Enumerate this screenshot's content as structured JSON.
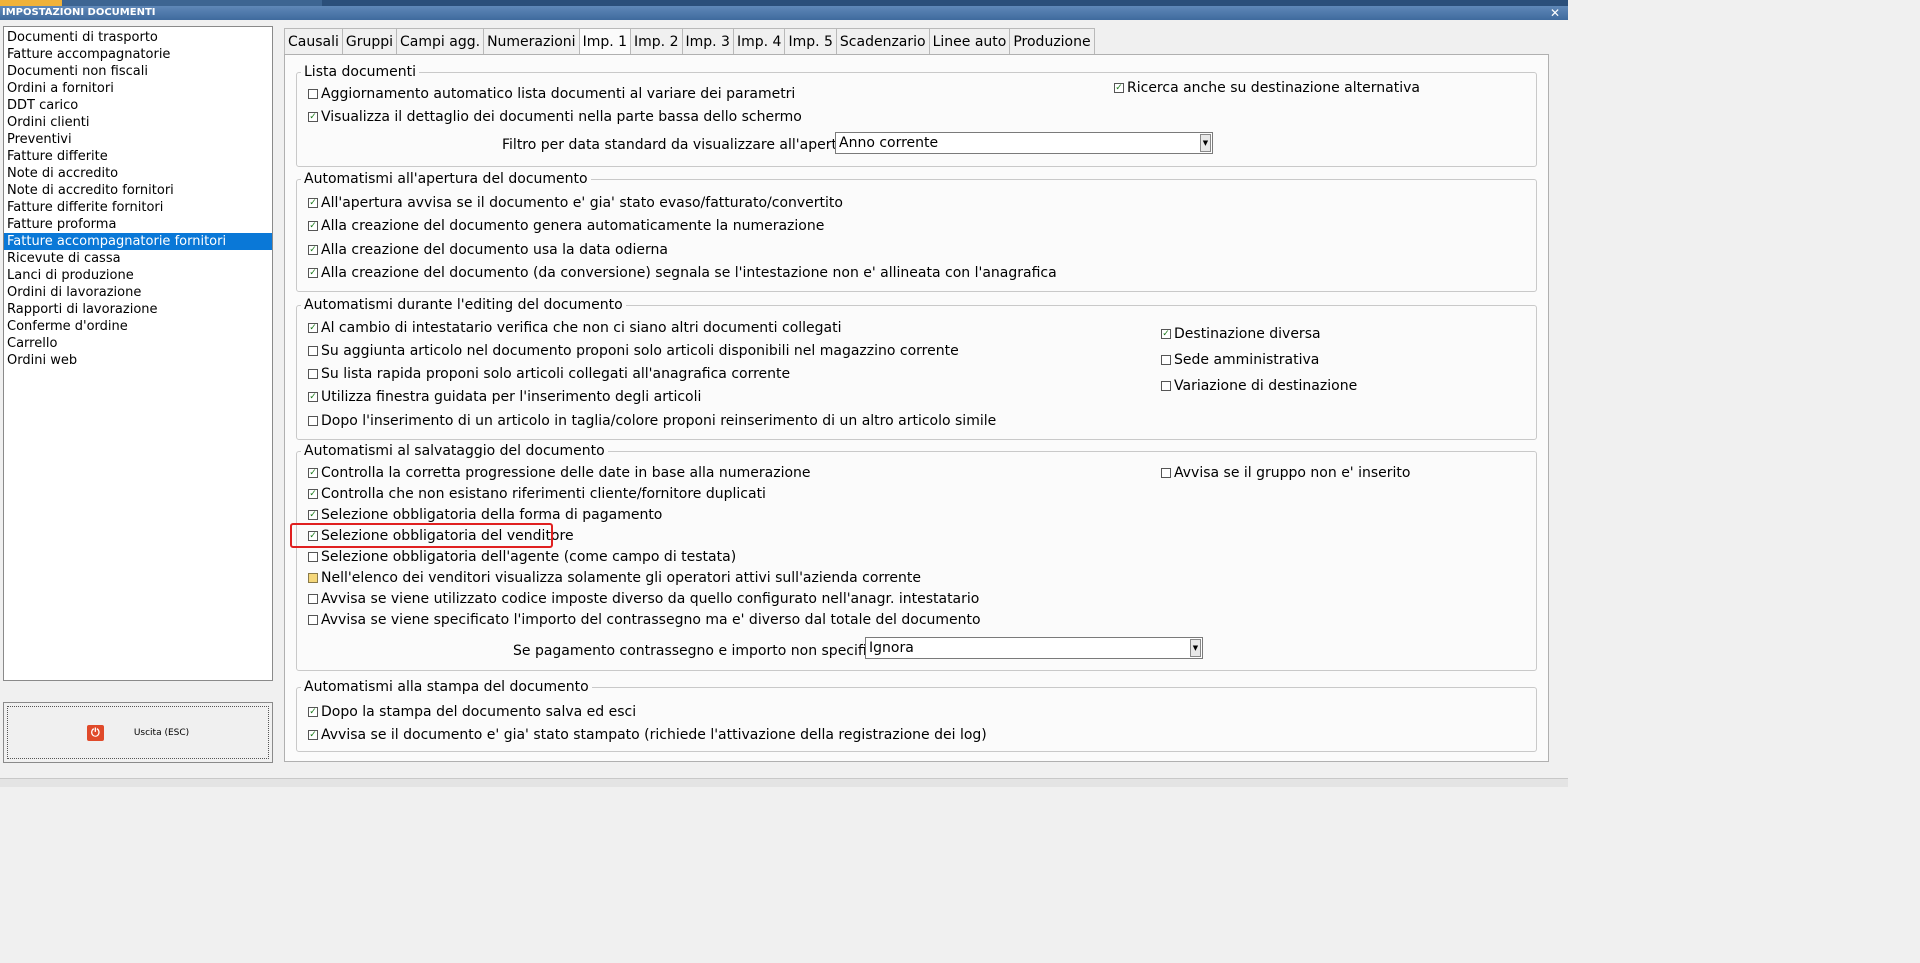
{
  "window": {
    "title": "IMPOSTAZIONI DOCUMENTI",
    "close_symbol": "✕"
  },
  "document_types": [
    "Documenti di trasporto",
    "Fatture accompagnatorie",
    "Documenti non fiscali",
    "Ordini a fornitori",
    "DDT carico",
    "Ordini clienti",
    "Preventivi",
    "Fatture differite",
    "Note di accredito",
    "Note di accredito fornitori",
    "Fatture differite fornitori",
    "Fatture proforma",
    "Fatture accompagnatorie fornitori",
    "Ricevute di cassa",
    "Lanci di produzione",
    "Ordini di lavorazione",
    "Rapporti di lavorazione",
    "Conferme d'ordine",
    "Carrello",
    "Ordini web"
  ],
  "selected_document_type": "Fatture accompagnatorie fornitori",
  "exit_button": {
    "label": "Uscita (ESC)",
    "icon": "power-icon"
  },
  "tabs": [
    "Causali",
    "Gruppi",
    "Campi agg.",
    "Numerazioni",
    "Imp. 1",
    "Imp. 2",
    "Imp. 3",
    "Imp. 4",
    "Imp. 5",
    "Scadenzario",
    "Linee auto",
    "Produzione"
  ],
  "active_tab": "Imp. 1",
  "lista": {
    "legend": "Lista documenti",
    "aggiornamento": {
      "label": "Aggiornamento automatico lista documenti al variare dei parametri",
      "checked": false
    },
    "dettaglio": {
      "label": "Visualizza il dettaglio dei documenti nella parte bassa dello schermo",
      "checked": true
    },
    "ricerca_alt": {
      "label": "Ricerca anche su destinazione alternativa",
      "checked": true
    },
    "filtro_label": "Filtro per data standard da visualizzare all'apertura :",
    "filtro_value": "Anno corrente"
  },
  "apertura": {
    "legend": "Automatismi all'apertura del documento",
    "items": [
      {
        "label": "All'apertura avvisa se il documento e' gia' stato evaso/fatturato/convertito",
        "checked": true
      },
      {
        "label": "Alla creazione del documento genera automaticamente la numerazione",
        "checked": true
      },
      {
        "label": "Alla creazione del documento usa la data odierna",
        "checked": true
      },
      {
        "label": "Alla creazione del documento (da conversione) segnala se l'intestazione non e' allineata con l'anagrafica",
        "checked": true
      }
    ]
  },
  "editing": {
    "legend": "Automatismi durante l'editing del documento",
    "items": [
      {
        "label": "Al cambio di intestatario verifica che non ci siano altri documenti collegati",
        "checked": true
      },
      {
        "label": "Su aggiunta articolo nel documento proponi solo articoli disponibili nel magazzino corrente",
        "checked": false
      },
      {
        "label": "Su lista rapida proponi solo articoli collegati all'anagrafica corrente",
        "checked": false
      },
      {
        "label": "Utilizza finestra guidata per l'inserimento degli articoli",
        "checked": true
      },
      {
        "label": "Dopo l'inserimento di un articolo in taglia/colore proponi reinserimento di un altro articolo simile",
        "checked": false
      }
    ],
    "right_items": [
      {
        "label": "Destinazione diversa",
        "checked": true
      },
      {
        "label": "Sede amministrativa",
        "checked": false
      },
      {
        "label": "Variazione di destinazione",
        "checked": false
      }
    ]
  },
  "salvataggio": {
    "legend": "Automatismi al salvataggio del documento",
    "items": [
      {
        "label": "Controlla la corretta progressione delle date in base alla numerazione",
        "checked": true
      },
      {
        "label": "Controlla che non esistano riferimenti cliente/fornitore duplicati",
        "checked": true
      },
      {
        "label": "Selezione obbligatoria della forma di pagamento",
        "checked": true
      },
      {
        "label": "Selezione obbligatoria del venditore",
        "checked": true
      },
      {
        "label": "Selezione obbligatoria dell'agente (come campo di testata)",
        "checked": false
      },
      {
        "label": "Nell'elenco dei venditori visualizza solamente gli operatori attivi sull'azienda corrente",
        "checked": "indeterminate"
      },
      {
        "label": "Avvisa se viene utilizzato codice imposte diverso da quello configurato nell'anagr. intestatario",
        "checked": false
      },
      {
        "label": "Avvisa se viene specificato l'importo del contrassegno ma e' diverso dal totale del documento",
        "checked": false
      }
    ],
    "gruppo": {
      "label": "Avvisa se il gruppo non e' inserito",
      "checked": false
    },
    "contrassegno_label": "Se pagamento contrassegno e importo non specificato :",
    "contrassegno_value": "Ignora"
  },
  "stampa": {
    "legend": "Automatismi alla stampa del documento",
    "items": [
      {
        "label": "Dopo la stampa del documento salva ed esci",
        "checked": true
      },
      {
        "label": "Avvisa se il documento e' gia' stato stampato (richiede l'attivazione della registrazione dei log)",
        "checked": true
      }
    ]
  }
}
